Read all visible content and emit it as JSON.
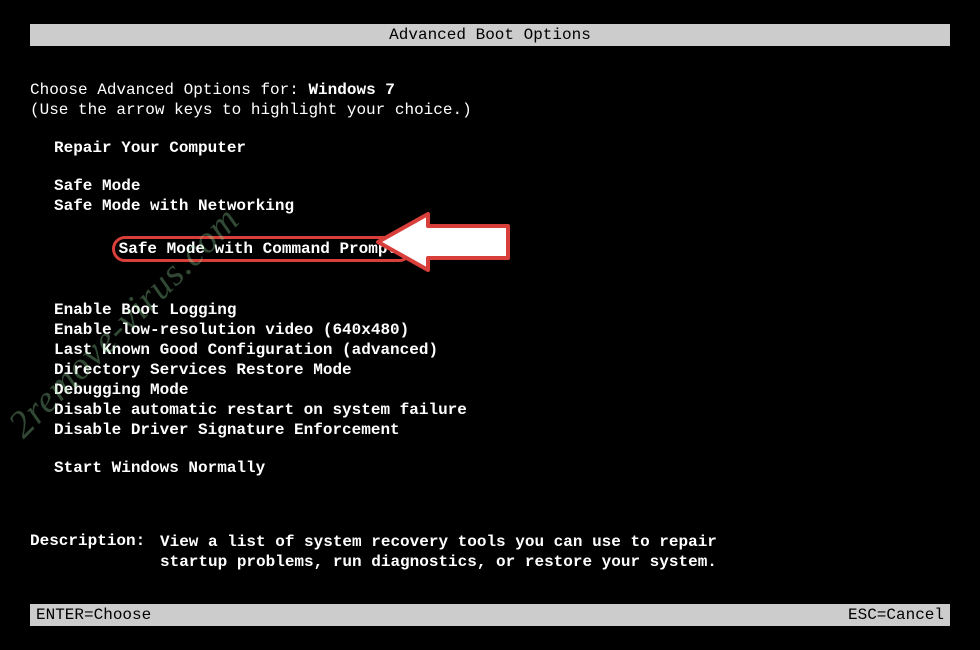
{
  "title": "Advanced Boot Options",
  "prompt": {
    "prefix": "Choose Advanced Options for: ",
    "os": "Windows 7",
    "hint": "(Use the arrow keys to highlight your choice.)"
  },
  "menu": {
    "repair": "Repair Your Computer",
    "safe_mode": "Safe Mode",
    "safe_mode_net": "Safe Mode with Networking",
    "safe_mode_cmd": "Safe Mode with Command Prompt",
    "boot_logging": "Enable Boot Logging",
    "low_res": "Enable low-resolution video (640x480)",
    "last_known": "Last Known Good Configuration (advanced)",
    "ds_restore": "Directory Services Restore Mode",
    "debugging": "Debugging Mode",
    "no_auto_restart": "Disable automatic restart on system failure",
    "no_sig_enforce": "Disable Driver Signature Enforcement",
    "start_normal": "Start Windows Normally"
  },
  "description": {
    "label": "Description:",
    "text1": "View a list of system recovery tools you can use to repair",
    "text2": "startup problems, run diagnostics, or restore your system."
  },
  "footer": {
    "enter": "ENTER=Choose",
    "esc": "ESC=Cancel"
  },
  "watermark": "2remove-virus.com"
}
